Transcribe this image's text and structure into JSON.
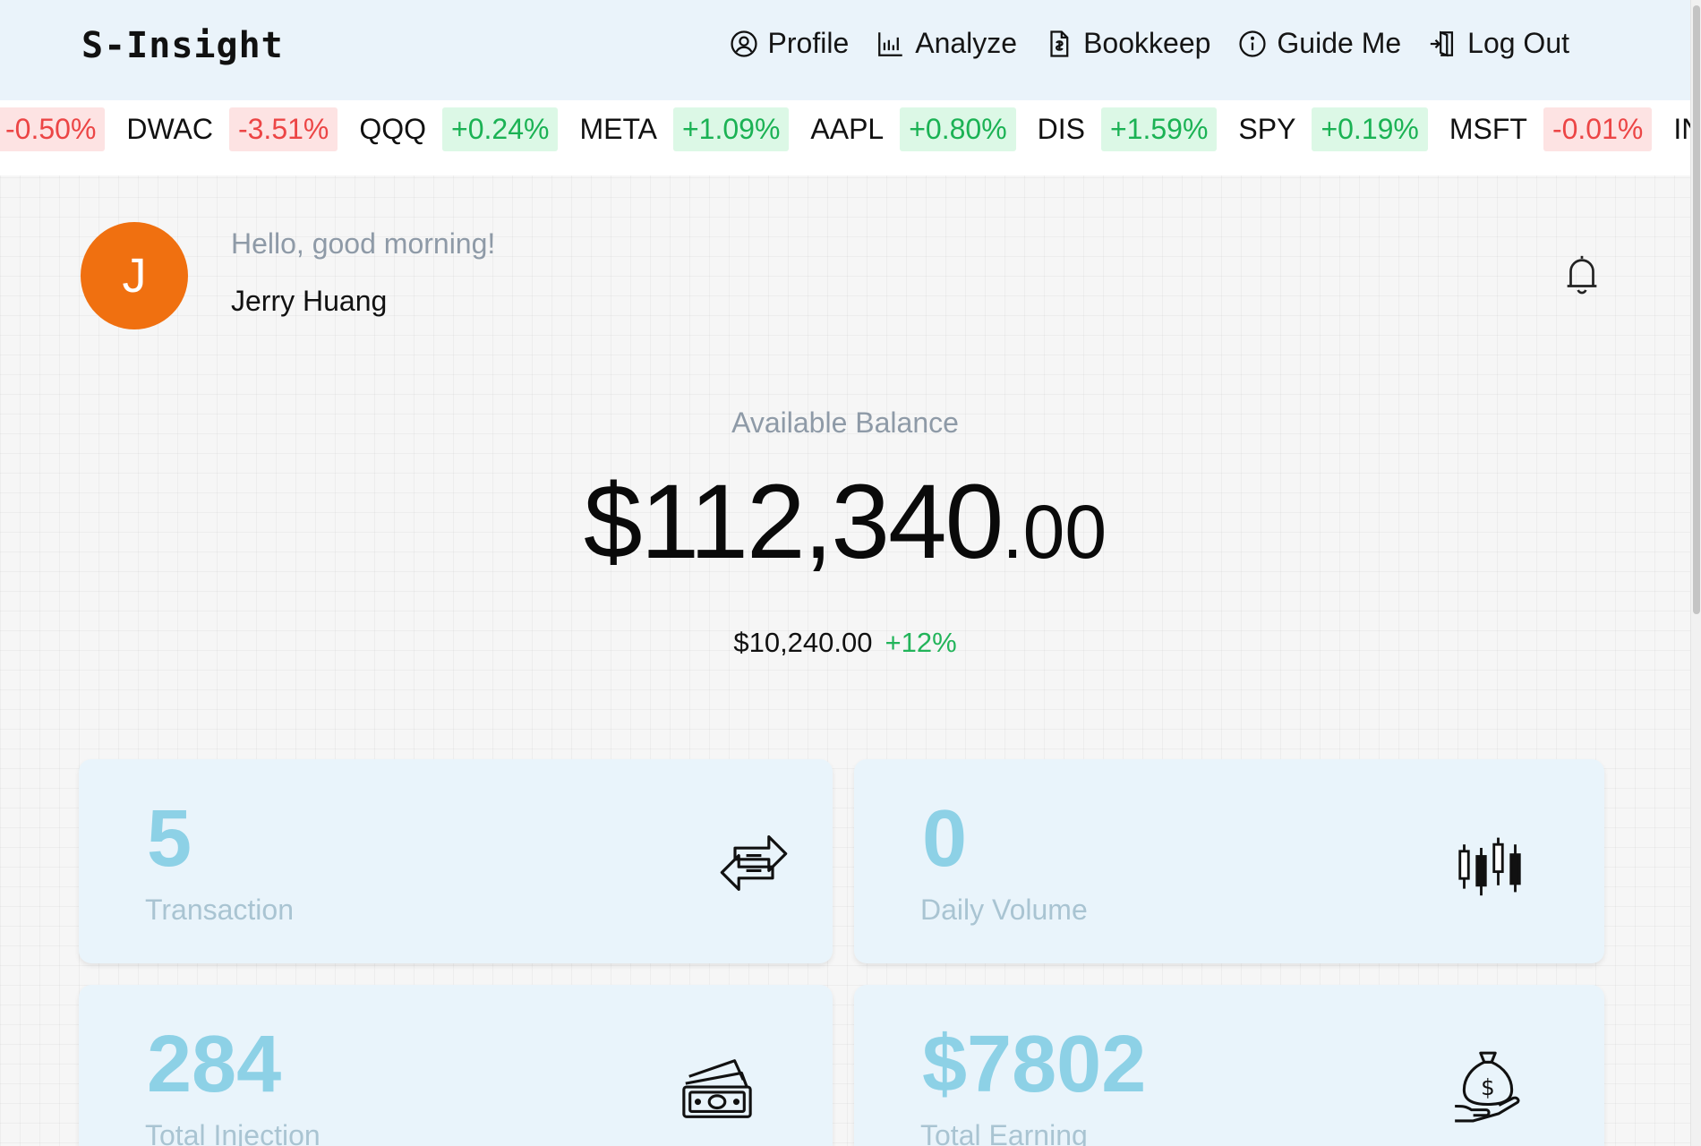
{
  "header": {
    "brand": "S-Insight",
    "nav": [
      {
        "label": "Profile",
        "icon": "profile-icon"
      },
      {
        "label": "Analyze",
        "icon": "chart-bar-icon"
      },
      {
        "label": "Bookkeep",
        "icon": "document-icon"
      },
      {
        "label": "Guide Me",
        "icon": "info-icon"
      },
      {
        "label": "Log Out",
        "icon": "logout-icon"
      }
    ]
  },
  "ticker": [
    {
      "symbol": "",
      "change": "-0.50%",
      "direction": "down"
    },
    {
      "symbol": "DWAC",
      "change": "-3.51%",
      "direction": "down"
    },
    {
      "symbol": "QQQ",
      "change": "+0.24%",
      "direction": "up"
    },
    {
      "symbol": "META",
      "change": "+1.09%",
      "direction": "up"
    },
    {
      "symbol": "AAPL",
      "change": "+0.80%",
      "direction": "up"
    },
    {
      "symbol": "DIS",
      "change": "+1.59%",
      "direction": "up"
    },
    {
      "symbol": "SPY",
      "change": "+0.19%",
      "direction": "up"
    },
    {
      "symbol": "MSFT",
      "change": "-0.01%",
      "direction": "down"
    },
    {
      "symbol": "INT",
      "change": "",
      "direction": ""
    }
  ],
  "user": {
    "greeting": "Hello, good morning!",
    "name": "Jerry Huang",
    "avatar_initial": "J",
    "avatar_color": "#f07010"
  },
  "balance": {
    "label": "Available Balance",
    "amount_whole": "$112,340",
    "amount_decimal": ".00",
    "change_amount": "$10,240.00",
    "change_pct": "+12%"
  },
  "stats": [
    {
      "value": "5",
      "label": "Transaction",
      "icon": "exchange-arrows-icon"
    },
    {
      "value": "0",
      "label": "Daily Volume",
      "icon": "candlestick-icon"
    },
    {
      "value": "284",
      "label": "Total Injection",
      "icon": "cash-stack-icon"
    },
    {
      "value": "$7802",
      "label": "Total Earning",
      "icon": "money-bag-hand-icon"
    }
  ],
  "colors": {
    "accent_up": "#1bb254",
    "accent_down": "#ec4545",
    "stat_value": "#8dd1e6",
    "header_bg": "#eaf3fa"
  }
}
